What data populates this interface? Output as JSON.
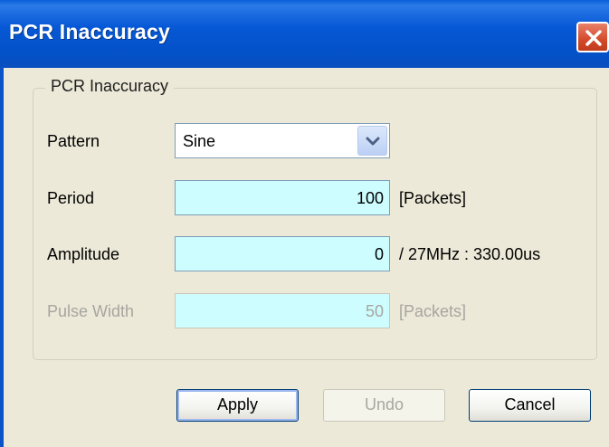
{
  "window": {
    "title": "PCR Inaccuracy"
  },
  "group": {
    "legend": "PCR Inaccuracy"
  },
  "pattern": {
    "label": "Pattern",
    "value": "Sine"
  },
  "period": {
    "label": "Period",
    "value": "100",
    "unit": "[Packets]"
  },
  "amplitude": {
    "label": "Amplitude",
    "value": "0",
    "unit": "/ 27MHz : 330.00us"
  },
  "pulse_width": {
    "label": "Pulse Width",
    "value": "50",
    "unit": "[Packets]",
    "enabled": false
  },
  "buttons": {
    "apply": "Apply",
    "undo": "Undo",
    "cancel": "Cancel"
  },
  "colors": {
    "titlebar": "#0758d6",
    "close": "#d44a2a",
    "field_bg": "#cdfdff",
    "dialog_bg": "#ece9d8"
  }
}
